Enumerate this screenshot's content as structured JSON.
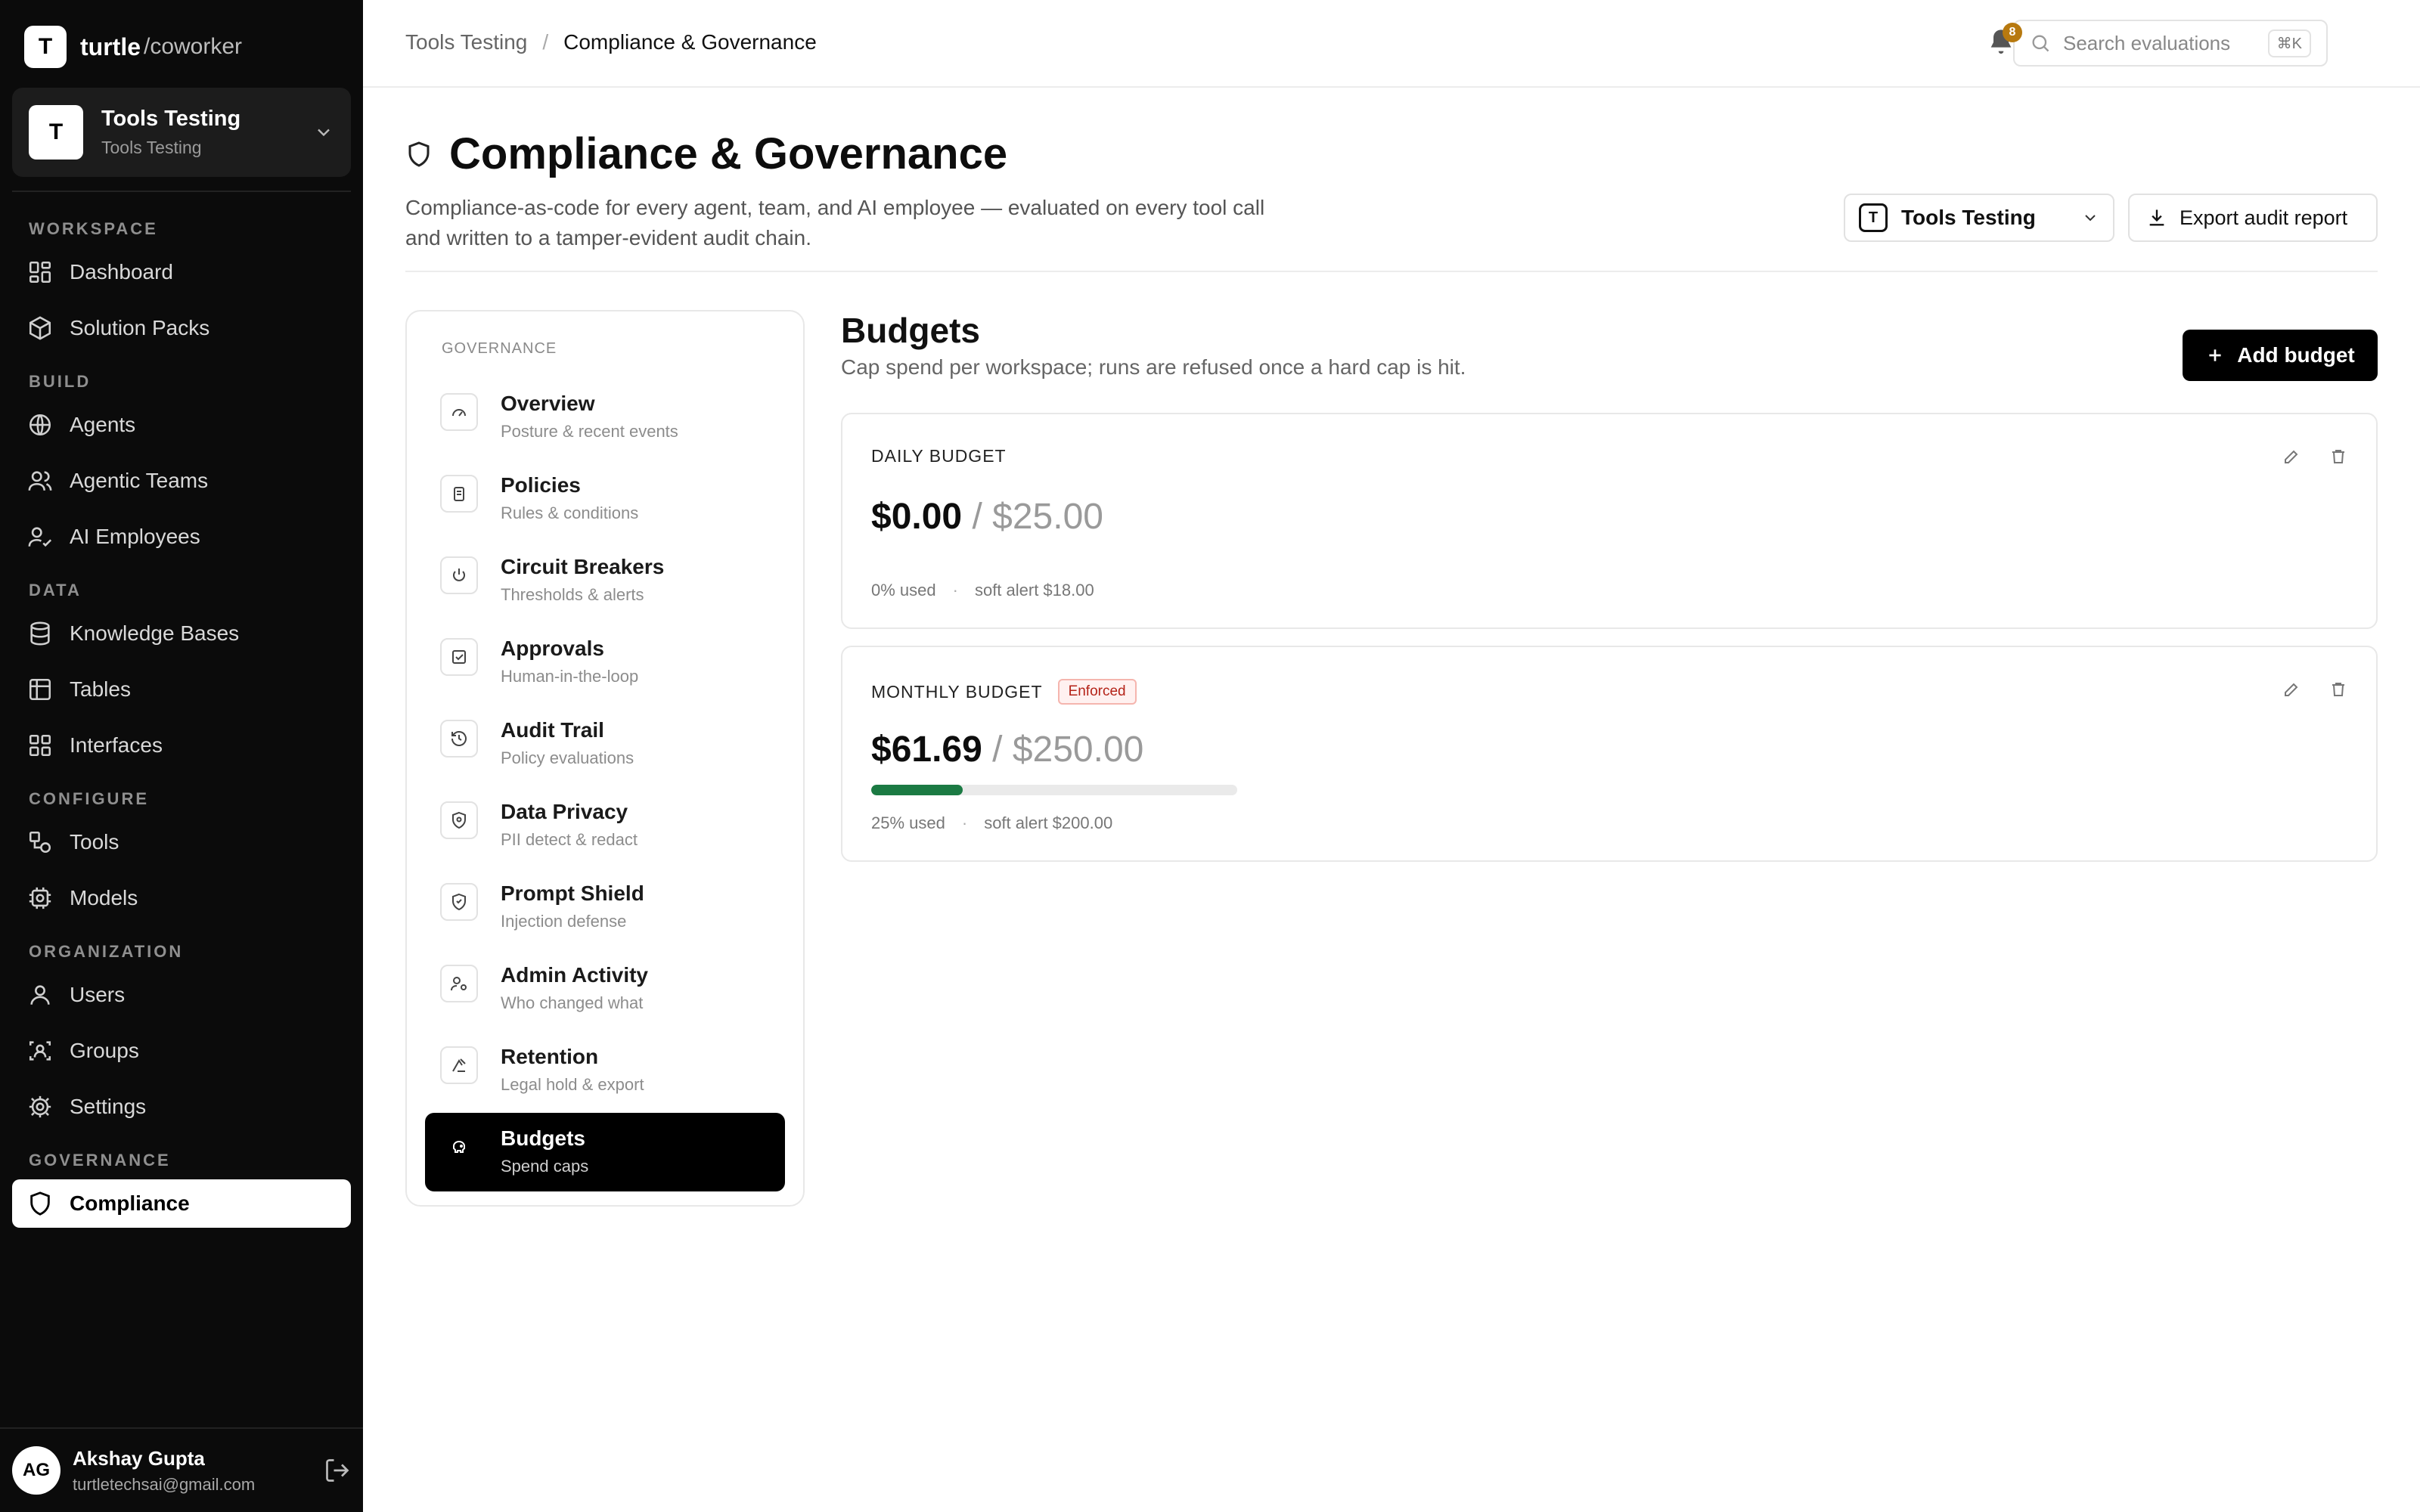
{
  "brand": {
    "logo_letter": "T",
    "name": "turtle",
    "suffix": "/coworker"
  },
  "workspace_switcher": {
    "avatar": "T",
    "title": "Tools Testing",
    "subtitle": "Tools Testing"
  },
  "sidebar": {
    "sections": [
      {
        "title": "WORKSPACE",
        "items": [
          {
            "label": "Dashboard",
            "icon": "grid-icon"
          },
          {
            "label": "Solution Packs",
            "icon": "package-icon"
          }
        ]
      },
      {
        "title": "BUILD",
        "items": [
          {
            "label": "Agents",
            "icon": "globe-icon"
          },
          {
            "label": "Agentic Teams",
            "icon": "users-icon"
          },
          {
            "label": "AI Employees",
            "icon": "user-check-icon"
          }
        ]
      },
      {
        "title": "DATA",
        "items": [
          {
            "label": "Knowledge Bases",
            "icon": "database-icon"
          },
          {
            "label": "Tables",
            "icon": "table-icon"
          },
          {
            "label": "Interfaces",
            "icon": "layout-icon"
          }
        ]
      },
      {
        "title": "CONFIGURE",
        "items": [
          {
            "label": "Tools",
            "icon": "shapes-icon"
          },
          {
            "label": "Models",
            "icon": "cpu-icon"
          }
        ]
      },
      {
        "title": "ORGANIZATION",
        "items": [
          {
            "label": "Users",
            "icon": "user-icon"
          },
          {
            "label": "Groups",
            "icon": "group-icon"
          },
          {
            "label": "Settings",
            "icon": "gear-icon"
          }
        ]
      },
      {
        "title": "GOVERNANCE",
        "items": [
          {
            "label": "Compliance",
            "icon": "shield-icon",
            "active": true
          }
        ]
      }
    ]
  },
  "user": {
    "initials": "AG",
    "name": "Akshay Gupta",
    "email": "turtletechsai@gmail.com"
  },
  "topbar": {
    "breadcrumb": [
      "Tools Testing",
      "Compliance & Governance"
    ],
    "search_placeholder": "Search evaluations",
    "search_shortcut": "⌘K",
    "notification_count": "8"
  },
  "page": {
    "title": "Compliance & Governance",
    "description": "Compliance-as-code for every agent, team, and AI employee — evaluated on every tool call and written to a tamper-evident audit chain.",
    "workspace_select": {
      "avatar": "T",
      "label": "Tools Testing"
    },
    "export_label": "Export audit report"
  },
  "governance_nav": {
    "section": "GOVERNANCE",
    "items": [
      {
        "label": "Overview",
        "sub": "Posture & recent events",
        "icon": "gauge-icon"
      },
      {
        "label": "Policies",
        "sub": "Rules & conditions",
        "icon": "clipboard-icon"
      },
      {
        "label": "Circuit Breakers",
        "sub": "Thresholds & alerts",
        "icon": "power-icon"
      },
      {
        "label": "Approvals",
        "sub": "Human-in-the-loop",
        "icon": "check-square-icon"
      },
      {
        "label": "Audit Trail",
        "sub": "Policy evaluations",
        "icon": "history-icon"
      },
      {
        "label": "Data Privacy",
        "sub": "PII detect & redact",
        "icon": "shield-lock-icon"
      },
      {
        "label": "Prompt Shield",
        "sub": "Injection defense",
        "icon": "shield-alert-icon"
      },
      {
        "label": "Admin Activity",
        "sub": "Who changed what",
        "icon": "user-cog-icon"
      },
      {
        "label": "Retention",
        "sub": "Legal hold & export",
        "icon": "archive-icon"
      },
      {
        "label": "Budgets",
        "sub": "Spend caps",
        "icon": "piggy-bank-icon",
        "active": true
      }
    ]
  },
  "budgets": {
    "title": "Budgets",
    "description": "Cap spend per workspace; runs are refused once a hard cap is hit.",
    "add_label": "Add budget",
    "cards": [
      {
        "label": "DAILY BUDGET",
        "badge": "",
        "spent": "$0.00",
        "cap": "/ $25.00",
        "used_fraction": 0.0,
        "used_text": "0% used",
        "alert_text": "soft alert $18.00"
      },
      {
        "label": "MONTHLY BUDGET",
        "badge": "Enforced",
        "spent": "$61.69",
        "cap": "/ $250.00",
        "used_fraction": 0.25,
        "used_text": "25% used",
        "alert_text": "soft alert $200.00"
      }
    ]
  },
  "colors": {
    "sidebar_bg": "#0b0b0b",
    "progress_fill": "#1b7a43",
    "badge_text": "#b42318",
    "notification_badge": "#b7790f"
  }
}
